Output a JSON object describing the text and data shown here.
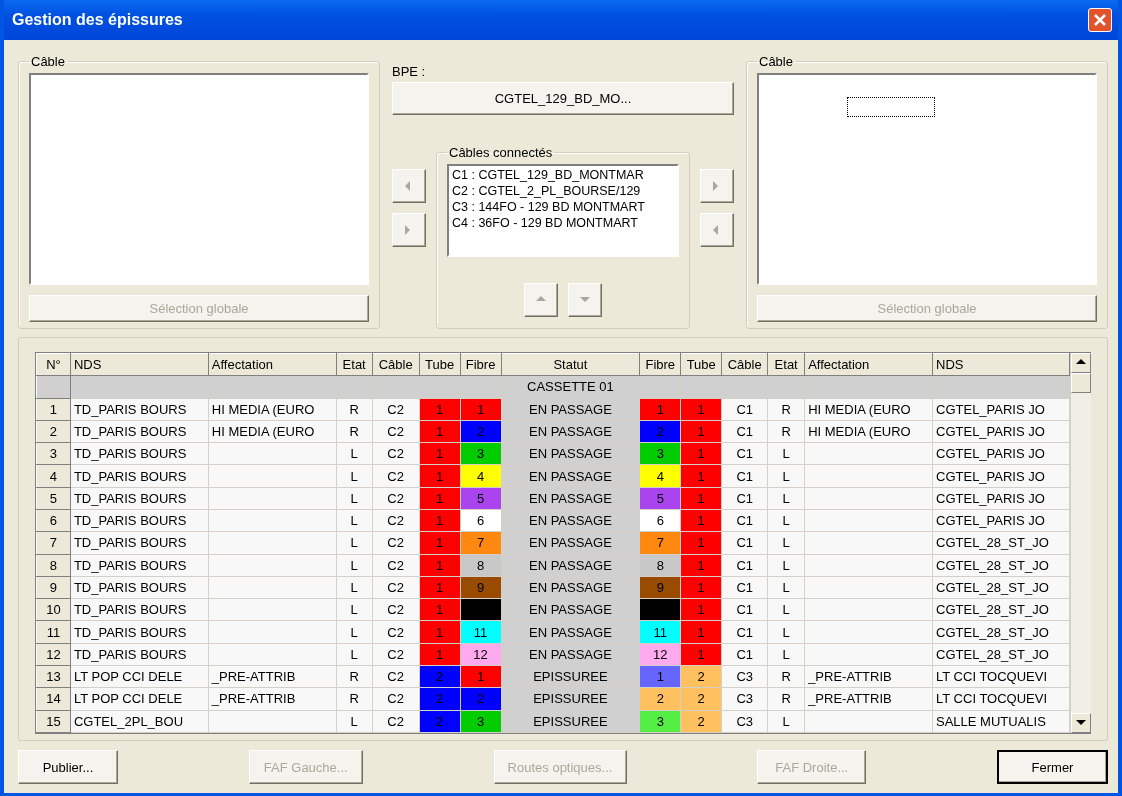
{
  "window": {
    "title": "Gestion des épissures"
  },
  "left_cable": {
    "label": "Câble",
    "button": {
      "label": "Sélection globale",
      "disabled": true
    }
  },
  "bpe": {
    "label": "BPE :",
    "button": {
      "label": "CGTEL_129_BD_MO...",
      "disabled": false
    }
  },
  "transfer_left": [
    {
      "disabled": true
    },
    {
      "disabled": true
    }
  ],
  "connected_cables": {
    "label": "Câbles connectés",
    "items": [
      {
        "text": "C1 : CGTEL_129_BD_MONTMAR"
      },
      {
        "text": "C2 : CGTEL_2_PL_BOURSE/129"
      },
      {
        "text": "C3 : 144FO - 129 BD MONTMART"
      },
      {
        "text": "C4 : 36FO - 129 BD MONTMART"
      }
    ],
    "order_buttons": [
      {
        "disabled": true
      },
      {
        "disabled": true
      }
    ]
  },
  "transfer_right": [
    {
      "disabled": true
    },
    {
      "disabled": true
    }
  ],
  "right_cable": {
    "label": "Câble",
    "button": {
      "label": "Sélection globale",
      "disabled": true
    }
  },
  "table": {
    "columns": [
      "N°",
      "NDS",
      "Affectation",
      "Etat",
      "Câble",
      "Tube",
      "Fibre",
      "Statut",
      "Fibre",
      "Tube",
      "Câble",
      "Etat",
      "Affectation",
      "NDS"
    ],
    "rows": [
      {
        "kind": "group",
        "label": "CASSETTE 01"
      },
      {
        "kind": "splice",
        "number": "1",
        "cells": [
          {
            "text": "TD_PARIS BOURS"
          },
          {
            "text": "HI MEDIA (EURO"
          },
          {
            "text": "R"
          },
          {
            "text": "C2"
          },
          {
            "text": "1",
            "color": "#ff0000"
          },
          {
            "text": "1",
            "color": "#ff0000"
          },
          {
            "text": "EN PASSAGE"
          },
          {
            "text": "1",
            "color": "#ff0000"
          },
          {
            "text": "1",
            "color": "#ff0000"
          },
          {
            "text": "C1"
          },
          {
            "text": "R"
          },
          {
            "text": "HI MEDIA (EURO"
          },
          {
            "text": "CGTEL_PARIS JO"
          }
        ]
      },
      {
        "kind": "splice",
        "number": "2",
        "cells": [
          {
            "text": "TD_PARIS BOURS"
          },
          {
            "text": "HI MEDIA (EURO"
          },
          {
            "text": "R"
          },
          {
            "text": "C2"
          },
          {
            "text": "1",
            "color": "#ff0000"
          },
          {
            "text": "2",
            "color": "#0000ff"
          },
          {
            "text": "EN PASSAGE"
          },
          {
            "text": "2",
            "color": "#0000ff"
          },
          {
            "text": "1",
            "color": "#ff0000"
          },
          {
            "text": "C1"
          },
          {
            "text": "R"
          },
          {
            "text": "HI MEDIA (EURO"
          },
          {
            "text": "CGTEL_PARIS JO"
          }
        ]
      },
      {
        "kind": "splice",
        "number": "3",
        "cells": [
          {
            "text": "TD_PARIS BOURS"
          },
          {},
          {
            "text": "L"
          },
          {
            "text": "C2"
          },
          {
            "text": "1",
            "color": "#ff0000"
          },
          {
            "text": "3",
            "color": "#00cc00"
          },
          {
            "text": "EN PASSAGE"
          },
          {
            "text": "3",
            "color": "#00cc00"
          },
          {
            "text": "1",
            "color": "#ff0000"
          },
          {
            "text": "C1"
          },
          {
            "text": "L"
          },
          {},
          {
            "text": "CGTEL_PARIS JO"
          }
        ]
      },
      {
        "kind": "splice",
        "number": "4",
        "cells": [
          {
            "text": "TD_PARIS BOURS"
          },
          {},
          {
            "text": "L"
          },
          {
            "text": "C2"
          },
          {
            "text": "1",
            "color": "#ff0000"
          },
          {
            "text": "4",
            "color": "#ffff00"
          },
          {
            "text": "EN PASSAGE"
          },
          {
            "text": "4",
            "color": "#ffff00"
          },
          {
            "text": "1",
            "color": "#ff0000"
          },
          {
            "text": "C1"
          },
          {
            "text": "L"
          },
          {},
          {
            "text": "CGTEL_PARIS JO"
          }
        ]
      },
      {
        "kind": "splice",
        "number": "5",
        "cells": [
          {
            "text": "TD_PARIS BOURS"
          },
          {},
          {
            "text": "L"
          },
          {
            "text": "C2"
          },
          {
            "text": "1",
            "color": "#ff0000"
          },
          {
            "text": "5",
            "color": "#aa44ee"
          },
          {
            "text": "EN PASSAGE"
          },
          {
            "text": "5",
            "color": "#aa44ee"
          },
          {
            "text": "1",
            "color": "#ff0000"
          },
          {
            "text": "C1"
          },
          {
            "text": "L"
          },
          {},
          {
            "text": "CGTEL_PARIS JO"
          }
        ]
      },
      {
        "kind": "splice",
        "number": "6",
        "cells": [
          {
            "text": "TD_PARIS BOURS"
          },
          {},
          {
            "text": "L"
          },
          {
            "text": "C2"
          },
          {
            "text": "1",
            "color": "#ff0000"
          },
          {
            "text": "6",
            "color": "#ffffff"
          },
          {
            "text": "EN PASSAGE"
          },
          {
            "text": "6",
            "color": "#ffffff"
          },
          {
            "text": "1",
            "color": "#ff0000"
          },
          {
            "text": "C1"
          },
          {
            "text": "L"
          },
          {},
          {
            "text": "CGTEL_PARIS JO"
          }
        ]
      },
      {
        "kind": "splice",
        "number": "7",
        "cells": [
          {
            "text": "TD_PARIS BOURS"
          },
          {},
          {
            "text": "L"
          },
          {
            "text": "C2"
          },
          {
            "text": "1",
            "color": "#ff0000"
          },
          {
            "text": "7",
            "color": "#ff8811"
          },
          {
            "text": "EN PASSAGE"
          },
          {
            "text": "7",
            "color": "#ff8811"
          },
          {
            "text": "1",
            "color": "#ff0000"
          },
          {
            "text": "C1"
          },
          {
            "text": "L"
          },
          {},
          {
            "text": "CGTEL_28_ST_JO"
          }
        ]
      },
      {
        "kind": "splice",
        "number": "8",
        "cells": [
          {
            "text": "TD_PARIS BOURS"
          },
          {},
          {
            "text": "L"
          },
          {
            "text": "C2"
          },
          {
            "text": "1",
            "color": "#ff0000"
          },
          {
            "text": "8",
            "color": "#c8c8c8"
          },
          {
            "text": "EN PASSAGE"
          },
          {
            "text": "8",
            "color": "#c8c8c8"
          },
          {
            "text": "1",
            "color": "#ff0000"
          },
          {
            "text": "C1"
          },
          {
            "text": "L"
          },
          {},
          {
            "text": "CGTEL_28_ST_JO"
          }
        ]
      },
      {
        "kind": "splice",
        "number": "9",
        "cells": [
          {
            "text": "TD_PARIS BOURS"
          },
          {},
          {
            "text": "L"
          },
          {
            "text": "C2"
          },
          {
            "text": "1",
            "color": "#ff0000"
          },
          {
            "text": "9",
            "color": "#994c00"
          },
          {
            "text": "EN PASSAGE"
          },
          {
            "text": "9",
            "color": "#994c00"
          },
          {
            "text": "1",
            "color": "#ff0000"
          },
          {
            "text": "C1"
          },
          {
            "text": "L"
          },
          {},
          {
            "text": "CGTEL_28_ST_JO"
          }
        ]
      },
      {
        "kind": "splice",
        "number": "10",
        "cells": [
          {
            "text": "TD_PARIS BOURS"
          },
          {},
          {
            "text": "L"
          },
          {
            "text": "C2"
          },
          {
            "text": "1",
            "color": "#ff0000"
          },
          {
            "color": "#000000"
          },
          {
            "text": "EN PASSAGE"
          },
          {
            "color": "#000000"
          },
          {
            "text": "1",
            "color": "#ff0000"
          },
          {
            "text": "C1"
          },
          {
            "text": "L"
          },
          {},
          {
            "text": "CGTEL_28_ST_JO"
          }
        ]
      },
      {
        "kind": "splice",
        "number": "11",
        "cells": [
          {
            "text": "TD_PARIS BOURS"
          },
          {},
          {
            "text": "L"
          },
          {
            "text": "C2"
          },
          {
            "text": "1",
            "color": "#ff0000"
          },
          {
            "text": "11",
            "color": "#00ffff"
          },
          {
            "text": "EN PASSAGE"
          },
          {
            "text": "11",
            "color": "#00ffff"
          },
          {
            "text": "1",
            "color": "#ff0000"
          },
          {
            "text": "C1"
          },
          {
            "text": "L"
          },
          {},
          {
            "text": "CGTEL_28_ST_JO"
          }
        ]
      },
      {
        "kind": "splice",
        "number": "12",
        "cells": [
          {
            "text": "TD_PARIS BOURS"
          },
          {},
          {
            "text": "L"
          },
          {
            "text": "C2"
          },
          {
            "text": "1",
            "color": "#ff0000"
          },
          {
            "text": "12",
            "color": "#ffaaee"
          },
          {
            "text": "EN PASSAGE"
          },
          {
            "text": "12",
            "color": "#ffaaee"
          },
          {
            "text": "1",
            "color": "#ff0000"
          },
          {
            "text": "C1"
          },
          {
            "text": "L"
          },
          {},
          {
            "text": "CGTEL_28_ST_JO"
          }
        ]
      },
      {
        "kind": "splice",
        "number": "13",
        "cells": [
          {
            "text": "LT POP CCI DELE"
          },
          {
            "text": "_PRE-ATTRIB"
          },
          {
            "text": "R"
          },
          {
            "text": "C2"
          },
          {
            "text": "2",
            "color": "#0000ff"
          },
          {
            "text": "1",
            "color": "#ff0000"
          },
          {
            "text": "EPISSUREE"
          },
          {
            "text": "1",
            "color": "#6666ff"
          },
          {
            "text": "2",
            "color": "#ffc060"
          },
          {
            "text": "C3"
          },
          {
            "text": "R"
          },
          {
            "text": "_PRE-ATTRIB"
          },
          {
            "text": "LT CCI TOCQUEVI"
          }
        ]
      },
      {
        "kind": "splice",
        "number": "14",
        "cells": [
          {
            "text": "LT POP CCI DELE"
          },
          {
            "text": "_PRE-ATTRIB"
          },
          {
            "text": "R"
          },
          {
            "text": "C2"
          },
          {
            "text": "2",
            "color": "#0000ff"
          },
          {
            "text": "2",
            "color": "#0000ff"
          },
          {
            "text": "EPISSUREE"
          },
          {
            "text": "2",
            "color": "#ffc060"
          },
          {
            "text": "2",
            "color": "#ffc060"
          },
          {
            "text": "C3"
          },
          {
            "text": "R"
          },
          {
            "text": "_PRE-ATTRIB"
          },
          {
            "text": "LT CCI TOCQUEVI"
          }
        ]
      },
      {
        "kind": "splice",
        "number": "15",
        "cells": [
          {
            "text": "CGTEL_2PL_BOU"
          },
          {},
          {
            "text": "L"
          },
          {
            "text": "C2"
          },
          {
            "text": "2",
            "color": "#0000ff"
          },
          {
            "text": "3",
            "color": "#00cc00"
          },
          {
            "text": "EPISSUREE"
          },
          {
            "text": "3",
            "color": "#55ee44"
          },
          {
            "text": "2",
            "color": "#ffc060"
          },
          {
            "text": "C3"
          },
          {
            "text": "L"
          },
          {},
          {
            "text": "SALLE MUTUALIS"
          }
        ]
      }
    ]
  },
  "buttons": [
    {
      "label": "Publier...",
      "disabled": false,
      "default": false
    },
    {
      "label": "FAF Gauche...",
      "disabled": true,
      "default": false
    },
    {
      "label": "Routes optiques...",
      "disabled": true,
      "default": false
    },
    {
      "label": "FAF Droite...",
      "disabled": true,
      "default": false
    },
    {
      "label": "Fermer",
      "disabled": false,
      "default": true
    }
  ]
}
